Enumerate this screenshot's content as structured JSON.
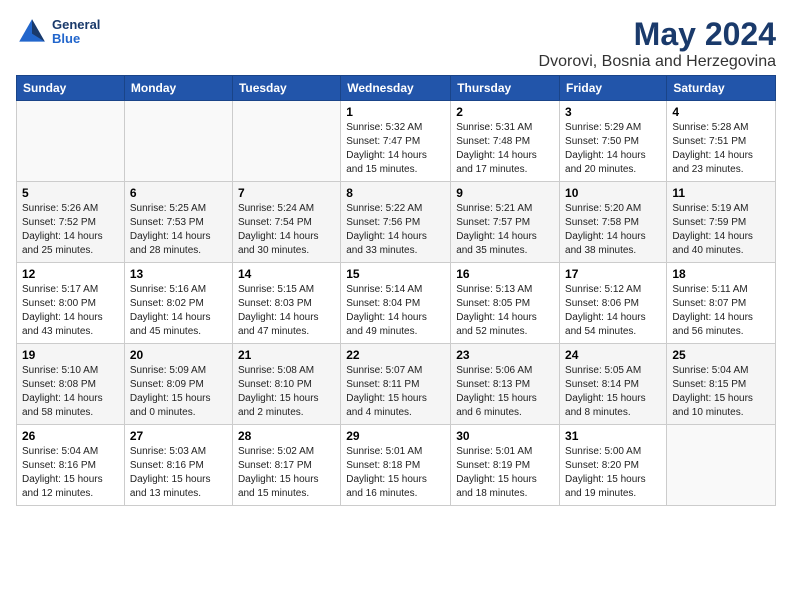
{
  "header": {
    "logo_general": "General",
    "logo_blue": "Blue",
    "title": "May 2024",
    "subtitle": "Dvorovi, Bosnia and Herzegovina"
  },
  "days_of_week": [
    "Sunday",
    "Monday",
    "Tuesday",
    "Wednesday",
    "Thursday",
    "Friday",
    "Saturday"
  ],
  "weeks": [
    [
      {
        "day": "",
        "info": ""
      },
      {
        "day": "",
        "info": ""
      },
      {
        "day": "",
        "info": ""
      },
      {
        "day": "1",
        "info": "Sunrise: 5:32 AM\nSunset: 7:47 PM\nDaylight: 14 hours\nand 15 minutes."
      },
      {
        "day": "2",
        "info": "Sunrise: 5:31 AM\nSunset: 7:48 PM\nDaylight: 14 hours\nand 17 minutes."
      },
      {
        "day": "3",
        "info": "Sunrise: 5:29 AM\nSunset: 7:50 PM\nDaylight: 14 hours\nand 20 minutes."
      },
      {
        "day": "4",
        "info": "Sunrise: 5:28 AM\nSunset: 7:51 PM\nDaylight: 14 hours\nand 23 minutes."
      }
    ],
    [
      {
        "day": "5",
        "info": "Sunrise: 5:26 AM\nSunset: 7:52 PM\nDaylight: 14 hours\nand 25 minutes."
      },
      {
        "day": "6",
        "info": "Sunrise: 5:25 AM\nSunset: 7:53 PM\nDaylight: 14 hours\nand 28 minutes."
      },
      {
        "day": "7",
        "info": "Sunrise: 5:24 AM\nSunset: 7:54 PM\nDaylight: 14 hours\nand 30 minutes."
      },
      {
        "day": "8",
        "info": "Sunrise: 5:22 AM\nSunset: 7:56 PM\nDaylight: 14 hours\nand 33 minutes."
      },
      {
        "day": "9",
        "info": "Sunrise: 5:21 AM\nSunset: 7:57 PM\nDaylight: 14 hours\nand 35 minutes."
      },
      {
        "day": "10",
        "info": "Sunrise: 5:20 AM\nSunset: 7:58 PM\nDaylight: 14 hours\nand 38 minutes."
      },
      {
        "day": "11",
        "info": "Sunrise: 5:19 AM\nSunset: 7:59 PM\nDaylight: 14 hours\nand 40 minutes."
      }
    ],
    [
      {
        "day": "12",
        "info": "Sunrise: 5:17 AM\nSunset: 8:00 PM\nDaylight: 14 hours\nand 43 minutes."
      },
      {
        "day": "13",
        "info": "Sunrise: 5:16 AM\nSunset: 8:02 PM\nDaylight: 14 hours\nand 45 minutes."
      },
      {
        "day": "14",
        "info": "Sunrise: 5:15 AM\nSunset: 8:03 PM\nDaylight: 14 hours\nand 47 minutes."
      },
      {
        "day": "15",
        "info": "Sunrise: 5:14 AM\nSunset: 8:04 PM\nDaylight: 14 hours\nand 49 minutes."
      },
      {
        "day": "16",
        "info": "Sunrise: 5:13 AM\nSunset: 8:05 PM\nDaylight: 14 hours\nand 52 minutes."
      },
      {
        "day": "17",
        "info": "Sunrise: 5:12 AM\nSunset: 8:06 PM\nDaylight: 14 hours\nand 54 minutes."
      },
      {
        "day": "18",
        "info": "Sunrise: 5:11 AM\nSunset: 8:07 PM\nDaylight: 14 hours\nand 56 minutes."
      }
    ],
    [
      {
        "day": "19",
        "info": "Sunrise: 5:10 AM\nSunset: 8:08 PM\nDaylight: 14 hours\nand 58 minutes."
      },
      {
        "day": "20",
        "info": "Sunrise: 5:09 AM\nSunset: 8:09 PM\nDaylight: 15 hours\nand 0 minutes."
      },
      {
        "day": "21",
        "info": "Sunrise: 5:08 AM\nSunset: 8:10 PM\nDaylight: 15 hours\nand 2 minutes."
      },
      {
        "day": "22",
        "info": "Sunrise: 5:07 AM\nSunset: 8:11 PM\nDaylight: 15 hours\nand 4 minutes."
      },
      {
        "day": "23",
        "info": "Sunrise: 5:06 AM\nSunset: 8:13 PM\nDaylight: 15 hours\nand 6 minutes."
      },
      {
        "day": "24",
        "info": "Sunrise: 5:05 AM\nSunset: 8:14 PM\nDaylight: 15 hours\nand 8 minutes."
      },
      {
        "day": "25",
        "info": "Sunrise: 5:04 AM\nSunset: 8:15 PM\nDaylight: 15 hours\nand 10 minutes."
      }
    ],
    [
      {
        "day": "26",
        "info": "Sunrise: 5:04 AM\nSunset: 8:16 PM\nDaylight: 15 hours\nand 12 minutes."
      },
      {
        "day": "27",
        "info": "Sunrise: 5:03 AM\nSunset: 8:16 PM\nDaylight: 15 hours\nand 13 minutes."
      },
      {
        "day": "28",
        "info": "Sunrise: 5:02 AM\nSunset: 8:17 PM\nDaylight: 15 hours\nand 15 minutes."
      },
      {
        "day": "29",
        "info": "Sunrise: 5:01 AM\nSunset: 8:18 PM\nDaylight: 15 hours\nand 16 minutes."
      },
      {
        "day": "30",
        "info": "Sunrise: 5:01 AM\nSunset: 8:19 PM\nDaylight: 15 hours\nand 18 minutes."
      },
      {
        "day": "31",
        "info": "Sunrise: 5:00 AM\nSunset: 8:20 PM\nDaylight: 15 hours\nand 19 minutes."
      },
      {
        "day": "",
        "info": ""
      }
    ]
  ]
}
